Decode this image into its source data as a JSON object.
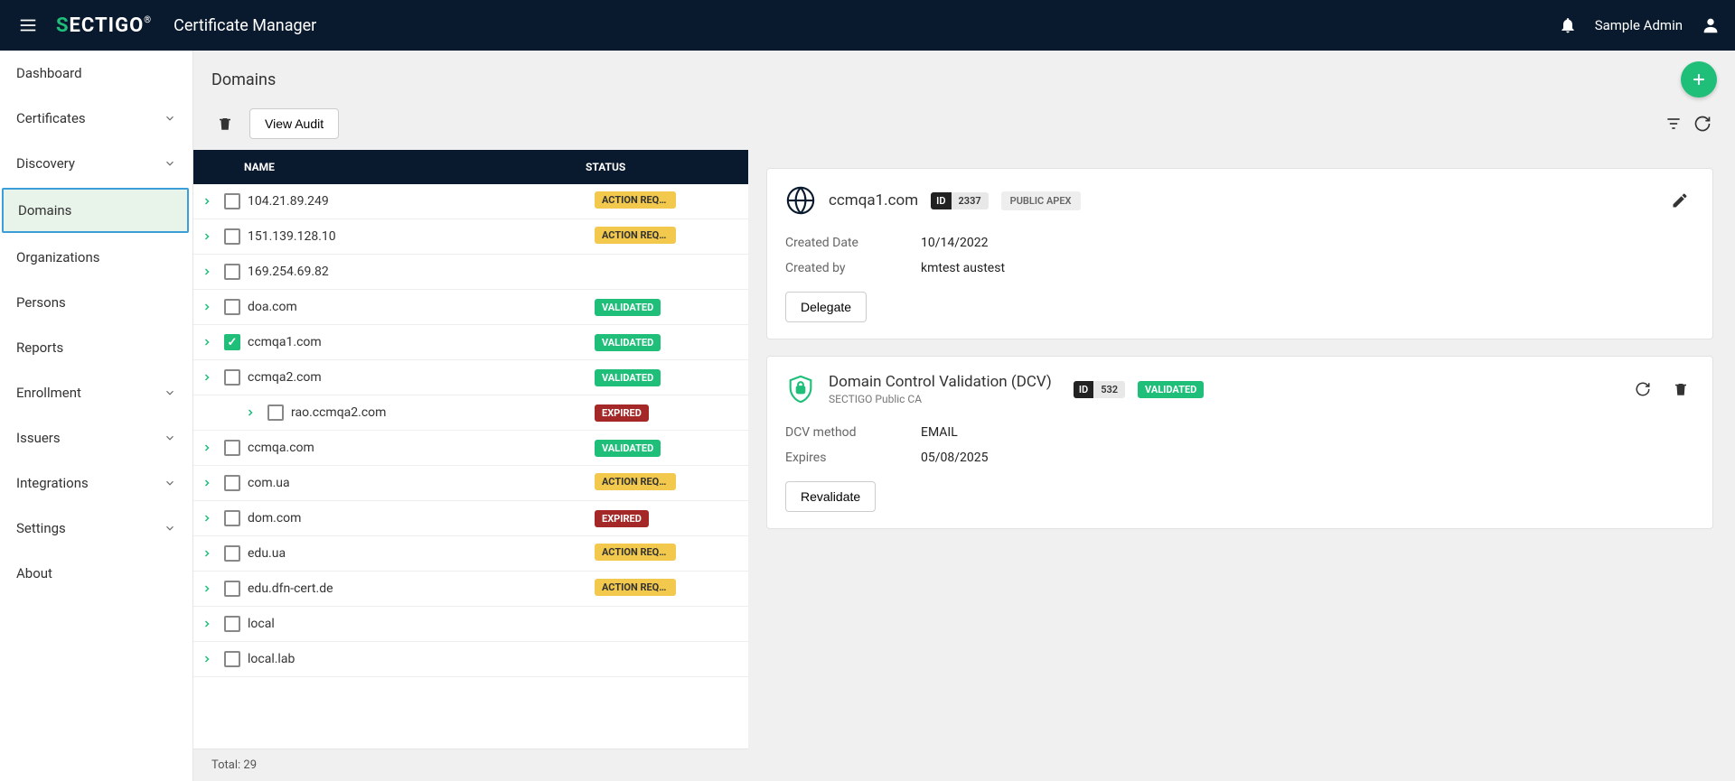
{
  "header": {
    "app_title": "Certificate Manager",
    "user_name": "Sample Admin",
    "logo_text_1": "S",
    "logo_text_2": "ECTIGO",
    "logo_reg": "®"
  },
  "sidebar": {
    "items": [
      {
        "label": "Dashboard",
        "expandable": false
      },
      {
        "label": "Certificates",
        "expandable": true
      },
      {
        "label": "Discovery",
        "expandable": true
      },
      {
        "label": "Domains",
        "expandable": false,
        "active": true
      },
      {
        "label": "Organizations",
        "expandable": false
      },
      {
        "label": "Persons",
        "expandable": false
      },
      {
        "label": "Reports",
        "expandable": false
      },
      {
        "label": "Enrollment",
        "expandable": true
      },
      {
        "label": "Issuers",
        "expandable": true
      },
      {
        "label": "Integrations",
        "expandable": true
      },
      {
        "label": "Settings",
        "expandable": true
      },
      {
        "label": "About",
        "expandable": false
      }
    ]
  },
  "page": {
    "title": "Domains",
    "view_audit_label": "View Audit",
    "columns": {
      "name": "NAME",
      "status": "STATUS"
    },
    "footer_total": "Total: 29"
  },
  "status_labels": {
    "action_required": "ACTION REQUI...",
    "validated": "VALIDATED",
    "expired": "EXPIRED"
  },
  "rows": [
    {
      "name": "104.21.89.249",
      "status": "action_required",
      "checked": false,
      "child": false
    },
    {
      "name": "151.139.128.10",
      "status": "action_required",
      "checked": false,
      "child": false
    },
    {
      "name": "169.254.69.82",
      "status": "",
      "checked": false,
      "child": false
    },
    {
      "name": "doa.com",
      "status": "validated",
      "checked": false,
      "child": false
    },
    {
      "name": "ccmqa1.com",
      "status": "validated",
      "checked": true,
      "child": false
    },
    {
      "name": "ccmqa2.com",
      "status": "validated",
      "checked": false,
      "child": false
    },
    {
      "name": "rao.ccmqa2.com",
      "status": "expired",
      "checked": false,
      "child": true
    },
    {
      "name": "ccmqa.com",
      "status": "validated",
      "checked": false,
      "child": false
    },
    {
      "name": "com.ua",
      "status": "action_required",
      "checked": false,
      "child": false
    },
    {
      "name": "dom.com",
      "status": "expired",
      "checked": false,
      "child": false
    },
    {
      "name": "edu.ua",
      "status": "action_required",
      "checked": false,
      "child": false
    },
    {
      "name": "edu.dfn-cert.de",
      "status": "action_required",
      "checked": false,
      "child": false
    },
    {
      "name": "local",
      "status": "",
      "checked": false,
      "child": false
    },
    {
      "name": "local.lab",
      "status": "",
      "checked": false,
      "child": false
    }
  ],
  "detail": {
    "domain_name": "ccmqa1.com",
    "id_label": "ID",
    "id_value": "2337",
    "apex_label": "PUBLIC APEX",
    "created_date_label": "Created Date",
    "created_date_value": "10/14/2022",
    "created_by_label": "Created by",
    "created_by_value": "kmtest austest",
    "delegate_label": "Delegate"
  },
  "dcv": {
    "title": "Domain Control Validation (DCV)",
    "subtitle": "SECTIGO Public CA",
    "id_label": "ID",
    "id_value": "532",
    "status": "VALIDATED",
    "method_label": "DCV method",
    "method_value": "EMAIL",
    "expires_label": "Expires",
    "expires_value": "05/08/2025",
    "revalidate_label": "Revalidate"
  }
}
